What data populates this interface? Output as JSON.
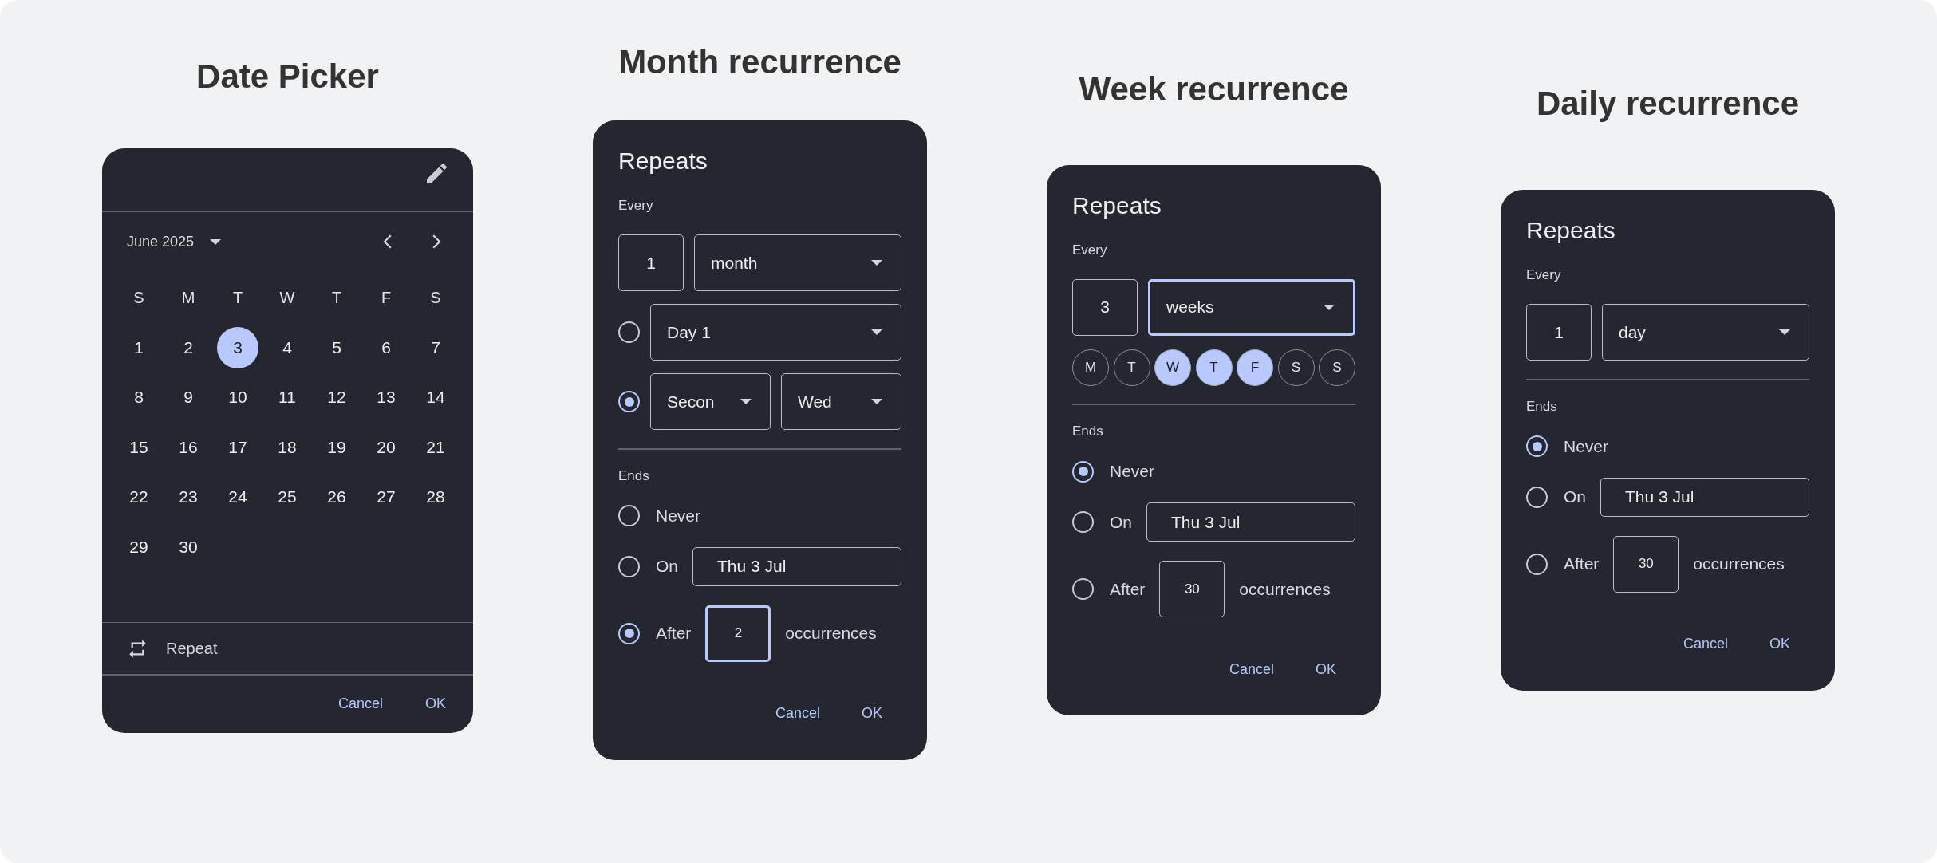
{
  "panels": [
    {
      "kind": "date_picker",
      "title": "Date Picker",
      "month_label": "June 2025",
      "weekdays": [
        "S",
        "M",
        "T",
        "W",
        "T",
        "F",
        "S"
      ],
      "days": [
        {
          "label": "1",
          "selected": false
        },
        {
          "label": "2",
          "selected": false
        },
        {
          "label": "3",
          "selected": true
        },
        {
          "label": "4",
          "selected": false
        },
        {
          "label": "5",
          "selected": false
        },
        {
          "label": "6",
          "selected": false
        },
        {
          "label": "7",
          "selected": false
        },
        {
          "label": "8",
          "selected": false
        },
        {
          "label": "9",
          "selected": false
        },
        {
          "label": "10",
          "selected": false
        },
        {
          "label": "11",
          "selected": false
        },
        {
          "label": "12",
          "selected": false
        },
        {
          "label": "13",
          "selected": false
        },
        {
          "label": "14",
          "selected": false
        },
        {
          "label": "15",
          "selected": false
        },
        {
          "label": "16",
          "selected": false
        },
        {
          "label": "17",
          "selected": false
        },
        {
          "label": "18",
          "selected": false
        },
        {
          "label": "19",
          "selected": false
        },
        {
          "label": "20",
          "selected": false
        },
        {
          "label": "21",
          "selected": false
        },
        {
          "label": "22",
          "selected": false
        },
        {
          "label": "23",
          "selected": false
        },
        {
          "label": "24",
          "selected": false
        },
        {
          "label": "25",
          "selected": false
        },
        {
          "label": "26",
          "selected": false
        },
        {
          "label": "27",
          "selected": false
        },
        {
          "label": "28",
          "selected": false
        },
        {
          "label": "29",
          "selected": false
        },
        {
          "label": "30",
          "selected": false
        }
      ],
      "repeat_label": "Repeat",
      "buttons": [
        "Cancel",
        "OK"
      ]
    },
    {
      "kind": "recurrence",
      "title": "Month recurrence",
      "heading": "Repeats",
      "every_label": "Every",
      "interval": {
        "value": "1",
        "focused": false
      },
      "unit": {
        "value": "month",
        "focused": false
      },
      "monthly_options": [
        {
          "selected": false,
          "dropdowns": [
            "Day 1"
          ]
        },
        {
          "selected": true,
          "dropdowns": [
            "Secon",
            "Wed"
          ]
        }
      ],
      "ends_label": "Ends",
      "end_options": [
        {
          "kind": "never",
          "label": "Never",
          "selected": false
        },
        {
          "kind": "date",
          "label": "On",
          "value": "Thu 3 Jul",
          "focused": false,
          "selected": false
        },
        {
          "kind": "count",
          "label": "After",
          "value": "2",
          "suffix": "occurrences",
          "focused": true,
          "selected": true
        }
      ],
      "buttons": [
        "Cancel",
        "OK"
      ]
    },
    {
      "kind": "recurrence",
      "title": "Week recurrence",
      "heading": "Repeats",
      "every_label": "Every",
      "interval": {
        "value": "3",
        "focused": false
      },
      "unit": {
        "value": "weeks",
        "focused": true
      },
      "day_chips": [
        {
          "label": "M",
          "selected": false
        },
        {
          "label": "T",
          "selected": false
        },
        {
          "label": "W",
          "selected": true
        },
        {
          "label": "T",
          "selected": true
        },
        {
          "label": "F",
          "selected": true
        },
        {
          "label": "S",
          "selected": false
        },
        {
          "label": "S",
          "selected": false
        }
      ],
      "ends_label": "Ends",
      "end_options": [
        {
          "kind": "never",
          "label": "Never",
          "selected": true
        },
        {
          "kind": "date",
          "label": "On",
          "value": "Thu 3 Jul",
          "focused": false,
          "selected": false
        },
        {
          "kind": "count",
          "label": "After",
          "value": "30",
          "suffix": "occurrences",
          "focused": false,
          "selected": false
        }
      ],
      "buttons": [
        "Cancel",
        "OK"
      ]
    },
    {
      "kind": "recurrence",
      "title": "Daily recurrence",
      "heading": "Repeats",
      "every_label": "Every",
      "interval": {
        "value": "1",
        "focused": false
      },
      "unit": {
        "value": "day",
        "focused": false
      },
      "ends_label": "Ends",
      "end_options": [
        {
          "kind": "never",
          "label": "Never",
          "selected": true
        },
        {
          "kind": "date",
          "label": "On",
          "value": "Thu 3 Jul",
          "focused": false,
          "selected": false
        },
        {
          "kind": "count",
          "label": "After",
          "value": "30",
          "suffix": "occurrences",
          "focused": false,
          "selected": false
        }
      ],
      "buttons": [
        "Cancel",
        "OK"
      ]
    }
  ]
}
